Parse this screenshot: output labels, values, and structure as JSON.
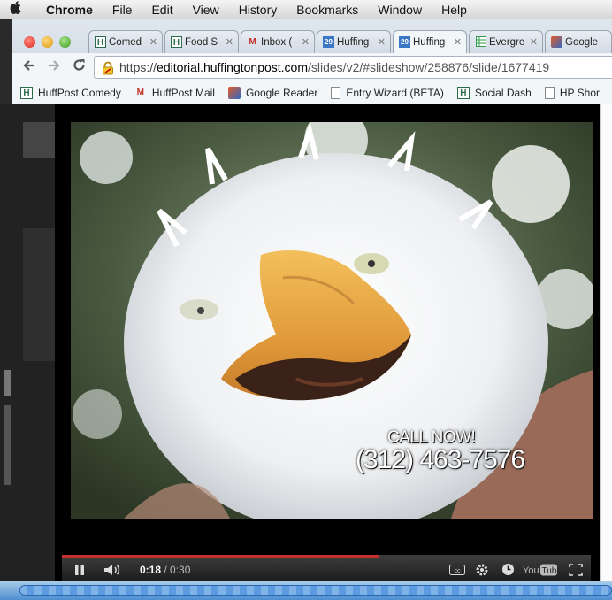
{
  "menubar": {
    "apple": "",
    "items": [
      "Chrome",
      "File",
      "Edit",
      "View",
      "History",
      "Bookmarks",
      "Window",
      "Help"
    ]
  },
  "tabs": [
    {
      "label": "Comed",
      "icon": "H"
    },
    {
      "label": "Food S",
      "icon": "H"
    },
    {
      "label": "Inbox (",
      "icon": "M"
    },
    {
      "label": "Huffing",
      "icon": "29"
    },
    {
      "label": "Huffing",
      "icon": "29"
    },
    {
      "label": "Evergre",
      "icon": "sheet"
    },
    {
      "label": "Google",
      "icon": "rss"
    }
  ],
  "omnibox": {
    "scheme": "https://",
    "host": "editorial.huffingtonpost.com",
    "path": "/slides/v2/#slideshow/258876/slide/1677419"
  },
  "bookmarks": [
    {
      "label": "HuffPost Comedy",
      "icon": "H"
    },
    {
      "label": "HuffPost Mail",
      "icon": "M"
    },
    {
      "label": "Google Reader",
      "icon": "rss"
    },
    {
      "label": "Entry Wizard (BETA)",
      "icon": "doc"
    },
    {
      "label": "Social Dash",
      "icon": "H"
    },
    {
      "label": "HP Shor",
      "icon": "doc"
    }
  ],
  "video": {
    "overlay_line1": "CALL NOW!",
    "overlay_line2": "(312) 463-7576",
    "current_time": "0:18",
    "duration": "/ 0:30",
    "progress": 0.6
  },
  "colors": {
    "progress": "#c4302b",
    "dock": "#4d8ed1"
  }
}
